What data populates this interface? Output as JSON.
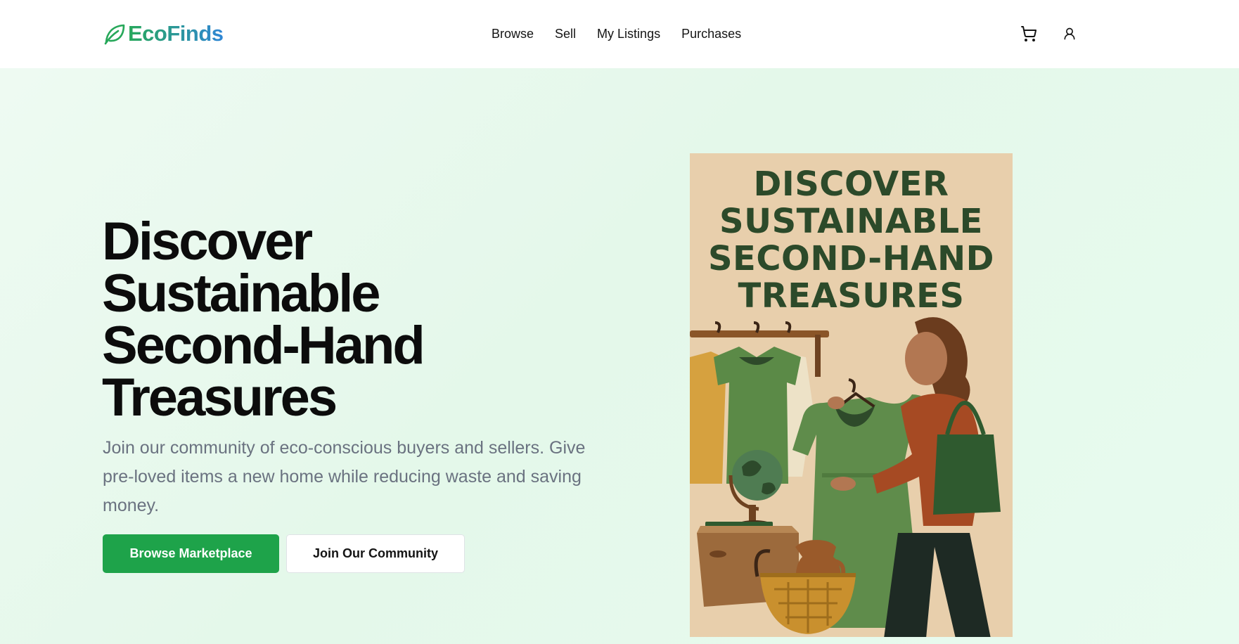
{
  "header": {
    "logo_text": "EcoFinds",
    "nav": [
      "Browse",
      "Sell",
      "My Listings",
      "Purchases"
    ]
  },
  "hero": {
    "title_lines": [
      "Discover",
      "Sustainable",
      "Second-Hand",
      "Treasures"
    ],
    "description": "Join our community of eco-conscious buyers and sellers. Give pre-loved items a new home while reducing waste and saving money.",
    "primary_button": "Browse Marketplace",
    "secondary_button": "Join Our Community"
  },
  "poster": {
    "title_lines": [
      "DISCOVER",
      "SUSTAINABLE",
      "SECOND-HAND",
      "TREASURES"
    ]
  },
  "colors": {
    "brand_green": "#1ea34a",
    "logo_gradient_start": "#27a85a",
    "logo_gradient_end": "#2f86d6",
    "hero_bg": "#e4f8ea",
    "poster_bg": "#e8cfac",
    "poster_text": "#2c4a2a"
  },
  "icons": [
    "leaf-icon",
    "cart-icon",
    "user-icon"
  ]
}
